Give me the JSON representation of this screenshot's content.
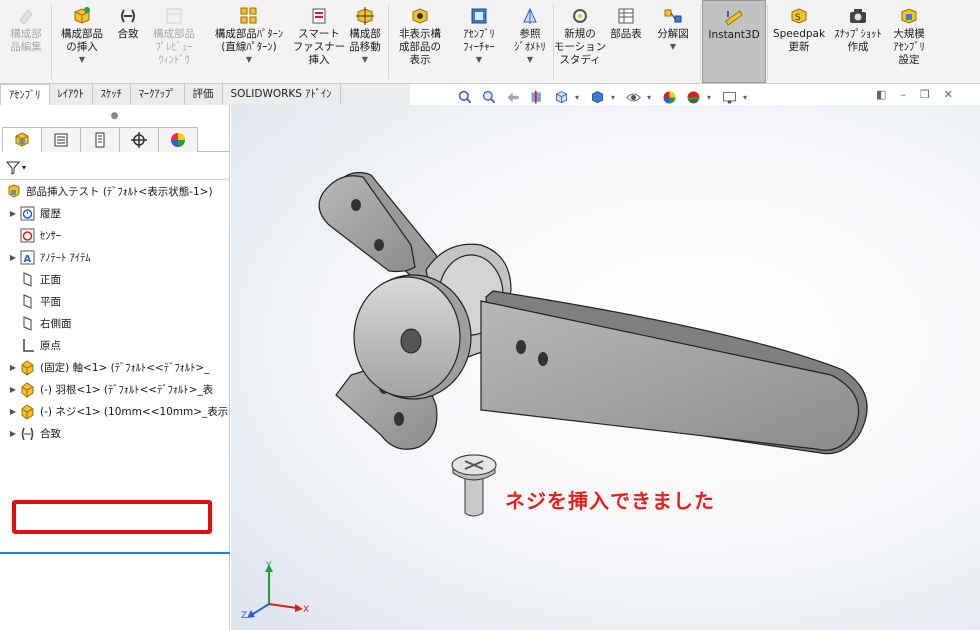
{
  "ribbon": {
    "buttons": [
      {
        "label": "構成部\n品編集",
        "icon": "edit-component-icon",
        "disabled": true,
        "caret": false
      },
      {
        "label": "構成部品\nの挿入",
        "icon": "insert-component-icon",
        "disabled": false,
        "caret": true
      },
      {
        "label": "合致",
        "icon": "mate-icon",
        "disabled": false,
        "caret": false
      },
      {
        "label": "構成部品\nﾌﾟﾚﾋﾞｭｰ\nｳｨﾝﾄﾞｳ",
        "icon": "preview-window-icon",
        "disabled": true,
        "caret": false
      },
      {
        "label": "構成部品ﾊﾟﾀｰﾝ\n(直線ﾊﾟﾀｰﾝ)",
        "icon": "linear-pattern-icon",
        "disabled": false,
        "caret": true
      },
      {
        "label": "スマート\nファスナー\n挿入",
        "icon": "smart-fastener-icon",
        "disabled": false,
        "caret": false
      },
      {
        "label": "構成部\n品移動",
        "icon": "move-component-icon",
        "disabled": false,
        "caret": true
      },
      {
        "label": "非表示構\n成部品の\n表示",
        "icon": "show-hidden-icon",
        "disabled": false,
        "caret": false
      },
      {
        "label": "ｱｾﾝﾌﾞﾘ\nﾌｨｰﾁｬｰ",
        "icon": "assembly-feature-icon",
        "disabled": false,
        "caret": true
      },
      {
        "label": "参照\nｼﾞｵﾒﾄﾘ",
        "icon": "reference-geometry-icon",
        "disabled": false,
        "caret": true
      },
      {
        "label": "新規の\nモーション\nスタディ",
        "icon": "motion-study-icon",
        "disabled": false,
        "caret": false
      },
      {
        "label": "部品表",
        "icon": "bom-icon",
        "disabled": false,
        "caret": false
      },
      {
        "label": "分解図",
        "icon": "exploded-view-icon",
        "disabled": false,
        "caret": true
      },
      {
        "label": "Instant3D",
        "icon": "instant3d-icon",
        "disabled": false,
        "caret": false,
        "active": true
      },
      {
        "label": "Speedpak\n更新",
        "icon": "speedpak-icon",
        "disabled": false,
        "caret": false
      },
      {
        "label": "ｽﾅｯﾌﾟｼｮｯﾄ\n作成",
        "icon": "snapshot-icon",
        "disabled": false,
        "caret": false
      },
      {
        "label": "大規模\nｱｾﾝﾌﾞﾘ\n設定",
        "icon": "large-assembly-icon",
        "disabled": false,
        "caret": false
      }
    ]
  },
  "command_tabs": [
    "ｱｾﾝﾌﾞﾘ",
    "ﾚｲｱｳﾄ",
    "ｽｹｯﾁ",
    "ﾏｰｸｱｯﾌﾟ",
    "評価",
    "SOLIDWORKS ｱﾄﾞｲﾝ"
  ],
  "hud_icons": [
    "zoom-to-fit-icon",
    "zoom-area-icon",
    "previous-view-icon",
    "section-view-icon",
    "view-orientation-icon",
    "display-style-icon",
    "hide-show-icon",
    "edit-appearance-icon",
    "apply-scene-icon",
    "view-settings-icon"
  ],
  "feature_tree": {
    "root": "部品挿入テスト (ﾃﾞﾌｫﾙﾄ<表示状態-1>)",
    "items": [
      {
        "label": "履歴",
        "icon": "history-icon",
        "expand": true
      },
      {
        "label": "ｾﾝｻｰ",
        "icon": "sensor-icon",
        "expand": false
      },
      {
        "label": "ｱﾉﾃｰﾄ ｱｲﾃﾑ",
        "icon": "annotation-icon",
        "expand": true
      },
      {
        "label": "正面",
        "icon": "plane-icon",
        "expand": false
      },
      {
        "label": "平面",
        "icon": "plane-icon",
        "expand": false
      },
      {
        "label": "右側面",
        "icon": "plane-icon",
        "expand": false
      },
      {
        "label": "原点",
        "icon": "origin-icon",
        "expand": false
      },
      {
        "label": "(固定) 軸<1> (ﾃﾞﾌｫﾙﾄ<<ﾃﾞﾌｫﾙﾄ>_",
        "icon": "part-icon",
        "expand": true
      },
      {
        "label": "(-) 羽根<1> (ﾃﾞﾌｫﾙﾄ<<ﾃﾞﾌｫﾙﾄ>_表",
        "icon": "part-icon",
        "expand": true
      },
      {
        "label": "(-) ネジ<1> (10mm<<10mm>_表示",
        "icon": "part-icon",
        "expand": true
      },
      {
        "label": "合致",
        "icon": "mates-icon",
        "expand": true
      }
    ]
  },
  "viewport": {
    "caption": "ネジを挿入できました",
    "axes": {
      "x": "X",
      "y": "Y",
      "z": "Z"
    }
  },
  "colors": {
    "highlight": "#e01010",
    "caption": "#e8201a",
    "active_button": "#c2c2c2"
  }
}
